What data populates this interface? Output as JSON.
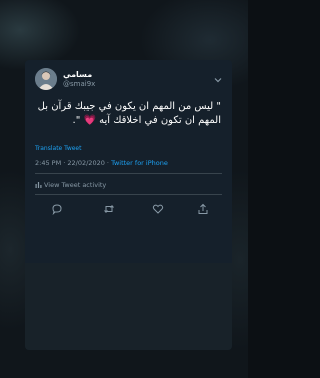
{
  "tweet": {
    "display_name": "مسامي",
    "handle": "@smai9x",
    "text": "\" ليس من المهم ان يكون في جيبك قرآن بل المهم ان تكون في اخلاقك آيه 💗 \".",
    "translate_label": "Translate Tweet",
    "timestamp": "2:45 PM · 22/02/2020 · ",
    "source": "Twitter for iPhone",
    "activity_label": "View Tweet activity"
  },
  "icons": {
    "more": "chevron-down-icon",
    "activity": "bar-chart-icon",
    "reply": "reply-icon",
    "retweet": "retweet-icon",
    "like": "heart-icon",
    "share": "share-icon"
  },
  "colors": {
    "card_background": "#15202b",
    "text_primary": "#ffffff",
    "text_secondary": "#8899a6",
    "link": "#1da1f2"
  }
}
